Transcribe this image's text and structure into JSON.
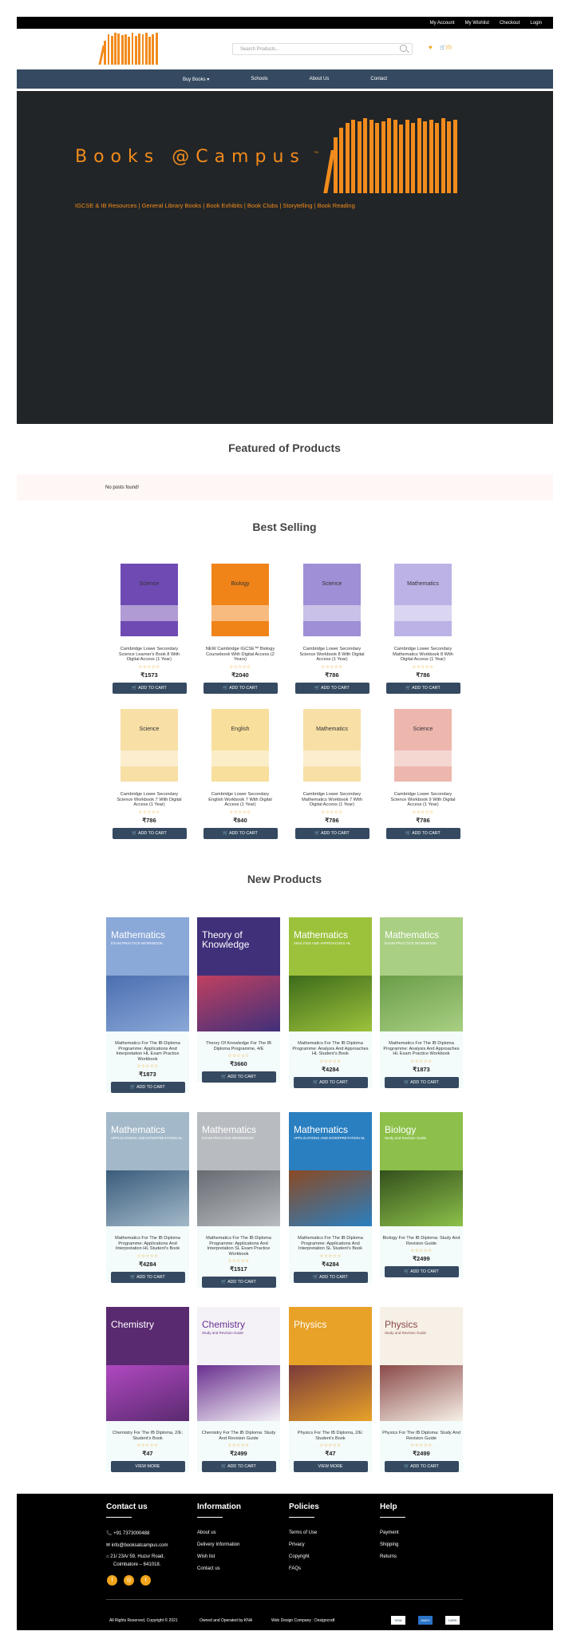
{
  "topbar": {
    "links": [
      "My Account",
      "My Wishlist",
      "Checkout",
      "Login"
    ]
  },
  "header": {
    "search_placeholder": "Search Products...",
    "cart_label": "(0)"
  },
  "nav": {
    "items": [
      "Buy Books",
      "Schools",
      "About Us",
      "Contact"
    ]
  },
  "hero": {
    "title": "Books @Campus",
    "tm": "TM",
    "subtitle": "IGCSE & IB Resources | General Library Books | Book Exhibits | Book Clubs | Storytelling | Book Reading"
  },
  "featured": {
    "heading": "Featured of Products",
    "empty": "No posts found!"
  },
  "best": {
    "heading": "Best Selling",
    "products": [
      {
        "title": "Cambridge Lower Secondary Science Learner's Book 8 With Digital Access (1 Year)",
        "price": "₹1573",
        "cover_text": "Science",
        "color": "#6f4ab3"
      },
      {
        "title": "NEW Cambridge IGCSE™ Biology Coursebook With Digital Access (2 Years)",
        "price": "₹2040",
        "cover_text": "Biology",
        "color": "#f08419"
      },
      {
        "title": "Cambridge Lower Secondary Science Workbook 8 With Digital Access (1 Year)",
        "price": "₹786",
        "cover_text": "Science",
        "color": "#9f8fd6"
      },
      {
        "title": "Cambridge Lower Secondary Mathematics Workbook 8 With Digital Access (1 Year)",
        "price": "₹786",
        "cover_text": "Mathematics",
        "color": "#bcb2e6"
      },
      {
        "title": "Cambridge Lower Secondary Science Workbook 7 With Digital Access (1 Year)",
        "price": "₹786",
        "cover_text": "Science",
        "color": "#f7dfa6"
      },
      {
        "title": "Cambridge Lower Secondary English Workbook 7 With Digital Access (1 Year)",
        "price": "₹840",
        "cover_text": "English",
        "color": "#f8df9c"
      },
      {
        "title": "Cambridge Lower Secondary Mathematics Workbook 7 With Digital Access (1 Year)",
        "price": "₹786",
        "cover_text": "Mathematics",
        "color": "#f7dfa6"
      },
      {
        "title": "Cambridge Lower Secondary Science Workbook 9 With Digital Access (1 Year)",
        "price": "₹786",
        "cover_text": "Science",
        "color": "#edb7ad"
      }
    ]
  },
  "button_label": "ADD TO CART",
  "view_label": "VIEW MORE",
  "stars": "☆☆☆☆☆",
  "newp": {
    "heading": "New Products",
    "products": [
      {
        "title": "Mathematics For The IB Diploma Programme: Applications And Interpretation HL Exam Practice Workbook",
        "price": "₹1873",
        "cover_text": "Mathematics",
        "cover_sub": "EXAM PRACTICE WORKBOOK",
        "color": "#8aa8d8",
        "accent": "#4b6fb0",
        "btn": "add"
      },
      {
        "title": "Theory Of Knowledge For The IB Diploma Programme, 4/E",
        "price": "₹3660",
        "cover_text": "Theory of Knowledge",
        "cover_sub": "",
        "color": "#40307a",
        "accent": "#c04060",
        "btn": "add"
      },
      {
        "title": "Mathematics For The IB Diploma Programme: Analysis And Approaches HL Student's Book",
        "price": "₹4284",
        "cover_text": "Mathematics",
        "cover_sub": "ANALYSIS AND APPROACHES HL",
        "color": "#9cc23c",
        "accent": "#3d6b1a",
        "btn": "add"
      },
      {
        "title": "Mathematics For The IB Diploma Programme: Analysis And Approaches HL Exam Practice Workbook",
        "price": "₹1873",
        "cover_text": "Mathematics",
        "cover_sub": "EXAM PRACTICE WORKBOOK",
        "color": "#a9cf83",
        "accent": "#6a9d48",
        "btn": "add"
      },
      {
        "title": "Mathematics For The IB Diploma Programme: Applications And Interpretation HL Student's Book",
        "price": "₹4284",
        "cover_text": "Mathematics",
        "cover_sub": "APPLICATIONS AND INTERPRETATION HL",
        "color": "#a3b9c9",
        "accent": "#3a5c7c",
        "btn": "add"
      },
      {
        "title": "Mathematics For The IB Diploma Programme: Applications And Interpretation SL Exam Practice Workbook",
        "price": "₹1517",
        "cover_text": "Mathematics",
        "cover_sub": "EXAM PRACTICE WORKBOOK",
        "color": "#b8bcc0",
        "accent": "#676b72",
        "btn": "add"
      },
      {
        "title": "Mathematics For The IB Diploma Programme: Applications And Interpretation SL Student's Book",
        "price": "₹4284",
        "cover_text": "Mathematics",
        "cover_sub": "APPLICATIONS AND INTERPRETATION SL",
        "color": "#2a7fc0",
        "accent": "#8a4a24",
        "btn": "add"
      },
      {
        "title": "Biology For The IB Diploma: Study And Revision Guide",
        "price": "₹2499",
        "cover_text": "Biology",
        "cover_sub": "Study and Revision Guide",
        "color": "#8cc04a",
        "accent": "#33501c",
        "btn": "add"
      },
      {
        "title": "Chemistry For The IB Diploma, 2/E: Student's Book",
        "price": "₹47",
        "cover_text": "Chemistry",
        "cover_sub": "",
        "color": "#5a2a70",
        "accent": "#b048c0",
        "btn": "view"
      },
      {
        "title": "Chemistry For The IB Diploma: Study And Revision Guide",
        "price": "₹2499",
        "cover_text": "Chemistry",
        "cover_sub": "Study and Revision Guide",
        "color": "#f4f2f6",
        "accent": "#6a3090",
        "btn": "add"
      },
      {
        "title": "Physics For The IB Diploma, 2/E: Student's Book",
        "price": "₹47",
        "cover_text": "Physics",
        "cover_sub": "",
        "color": "#e8a228",
        "accent": "#7a3a3a",
        "btn": "view"
      },
      {
        "title": "Physics For The IB Diploma: Study And Revision Guide",
        "price": "₹2499",
        "cover_text": "Physics",
        "cover_sub": "Study and Revision Guide",
        "color": "#f6f0e6",
        "accent": "#8a4a4a",
        "btn": "add"
      }
    ]
  },
  "footer": {
    "contact": {
      "heading": "Contact us",
      "phone": "+91 7373000488",
      "email": "info@booksatcampus.com",
      "address1": "21/ 23A/ 59, Huzur Road,",
      "address2": "Coimbatore – 641018."
    },
    "information": {
      "heading": "Information",
      "links": [
        "About us",
        "Delivery Information",
        "Wish list",
        "Contact us"
      ]
    },
    "policies": {
      "heading": "Policies",
      "links": [
        "Terms of Use",
        "Privacy",
        "Copyright",
        "FAQs"
      ]
    },
    "help": {
      "heading": "Help",
      "links": [
        "Payment",
        "Shipping",
        "Returns"
      ]
    },
    "copyright": "All Rights Reserved, Copyright © 2021",
    "owned": "Owned and Operated by KNA",
    "design": "Web Design Company : Designcraft",
    "payments": [
      "VISA",
      "AMEX",
      "CARD"
    ]
  }
}
